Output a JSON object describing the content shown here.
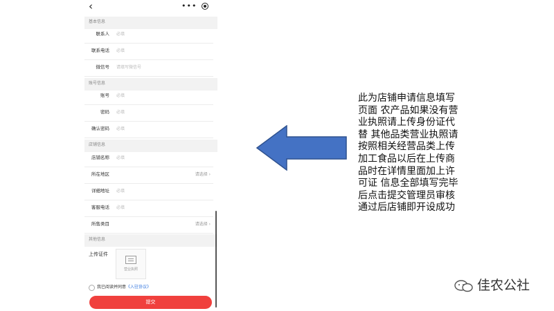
{
  "sections": {
    "basic": "基本信息",
    "account": "账号信息",
    "store": "店铺信息",
    "other": "其他信息"
  },
  "fields": {
    "contact": {
      "label": "联系人",
      "placeholder": "必填"
    },
    "phone": {
      "label": "联系电话",
      "placeholder": "必填"
    },
    "wechat": {
      "label": "微信号",
      "placeholder": "请填写微信号"
    },
    "account": {
      "label": "账号",
      "placeholder": "必填"
    },
    "password": {
      "label": "密码",
      "placeholder": "必填"
    },
    "confirm_password": {
      "label": "确认密码",
      "placeholder": "必填"
    },
    "store_name": {
      "label": "店铺名称",
      "placeholder": "必填"
    },
    "region": {
      "label": "所在地区",
      "placeholder": "请选择 ›"
    },
    "address": {
      "label": "详细地址",
      "placeholder": "必填"
    },
    "service_phone": {
      "label": "客服电话",
      "placeholder": "必填"
    },
    "category": {
      "label": "所售类目",
      "placeholder": "请选择 ›"
    }
  },
  "upload": {
    "label": "上传证件",
    "caption": "营业执照"
  },
  "agreement": {
    "text": "我已阅读并同意",
    "link": "《入驻协议》"
  },
  "submit_label": "提交",
  "annotation": "此为店铺申请信息填写页面 农产品如果没有营业执照请上传身份证代替 其他品类营业执照请按照相关经营品类上传 加工食品以后在上传商品时在详情里面加上许可证 信息全部填写完毕后点击提交管理员审核通过后店铺即开设成功",
  "watermark": "佳农公社",
  "colors": {
    "arrow": "#4472c4",
    "arrow_border": "#2f528f",
    "submit": "#f0403d",
    "link": "#3a7be0"
  }
}
